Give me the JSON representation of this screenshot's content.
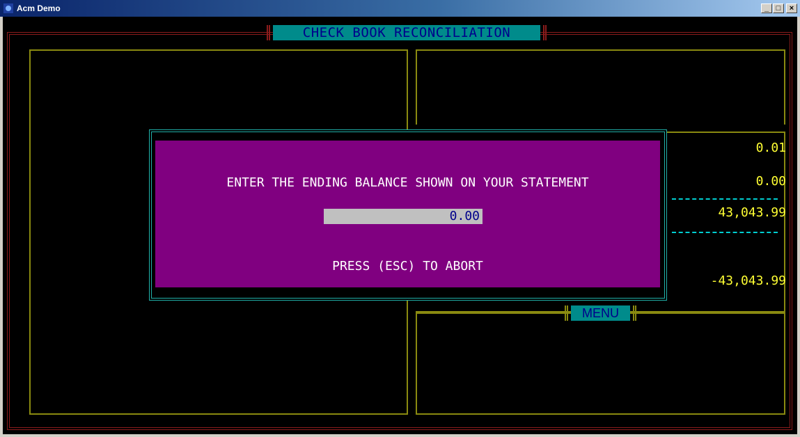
{
  "window": {
    "title": "Acm Demo",
    "minimize": "_",
    "maximize": "□",
    "close": "×"
  },
  "header": {
    "title": "CHECK BOOK RECONCILIATION"
  },
  "summary": {
    "values": [
      "0.01",
      "0.00",
      "43,043.99",
      "-43,043.99"
    ]
  },
  "menu": {
    "label": "MENU"
  },
  "dialog": {
    "prompt": "ENTER THE ENDING BALANCE SHOWN ON YOUR STATEMENT",
    "input_value": "0.00",
    "abort_hint": "PRESS (ESC) TO ABORT"
  },
  "colors": {
    "console_bg": "#000000",
    "dialog_bg": "#800080",
    "banner_bg": "#008b8b",
    "banner_text": "#00008b",
    "value_text": "#ffff33",
    "frame_red": "#8b1c1c",
    "frame_yellow": "#8a8a10"
  },
  "icons": {
    "app": "app-icon"
  }
}
